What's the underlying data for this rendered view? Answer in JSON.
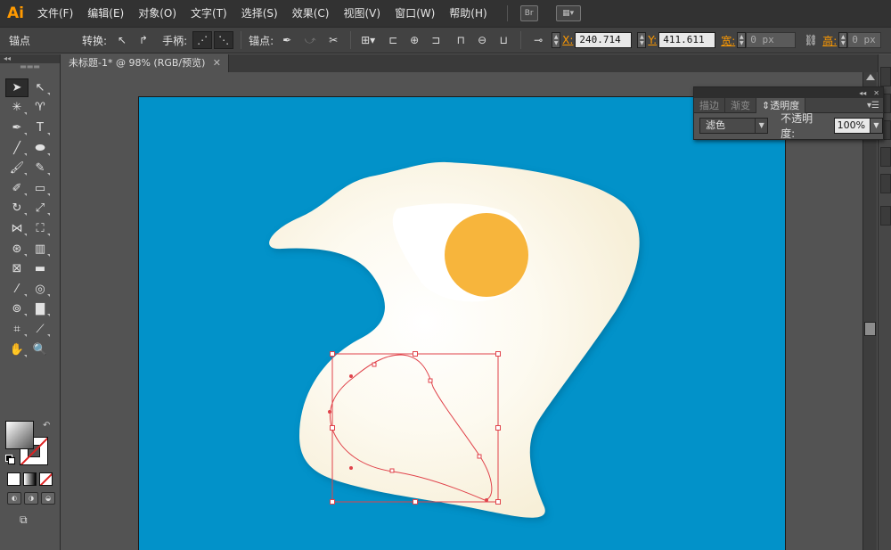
{
  "app": {
    "logo": "Ai",
    "brand_color": "#ff9a00"
  },
  "menubar": {
    "items": [
      "文件(F)",
      "编辑(E)",
      "对象(O)",
      "文字(T)",
      "选择(S)",
      "效果(C)",
      "视图(V)",
      "窗口(W)",
      "帮助(H)"
    ],
    "bridge_icon": "Br"
  },
  "controlbar": {
    "selection_label": "锚点",
    "convert_label": "转换:",
    "handles_label": "手柄:",
    "anchors_label": "锚点:",
    "x_label": "X:",
    "x_value": "240.714",
    "y_label": "Y:",
    "y_value": "411.611",
    "w_label": "宽:",
    "w_value": "0 px",
    "h_label": "高:",
    "h_value": "0 px"
  },
  "document": {
    "tab_title": "未标题-1* @ 98% (RGB/预览)",
    "close": "✕"
  },
  "panel": {
    "tabs": [
      "描边",
      "渐变",
      "透明度"
    ],
    "active_tab": "透明度",
    "blend_mode": "滤色",
    "opacity_label": "不透明度:",
    "opacity_value": "100%"
  },
  "colors": {
    "artboard": "#0292c9",
    "egg_white": "#fbf6e6",
    "yolk": "#f7b53c",
    "path_selection": "#e0424a"
  }
}
